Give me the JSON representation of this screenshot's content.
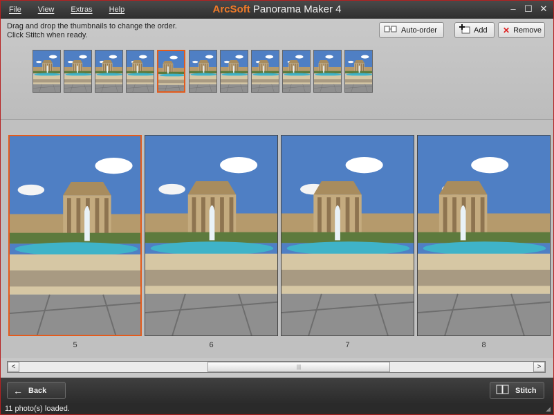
{
  "menu": {
    "file": "File",
    "view": "View",
    "extras": "Extras",
    "help": "Help"
  },
  "title": {
    "brand": "ArcSoft",
    "product": " Panorama Maker 4"
  },
  "window_controls": {
    "minimize": "–",
    "maximize": "☐",
    "close": "✕"
  },
  "instructions": {
    "line1": "Drag and drop the thumbnails to change the order.",
    "line2": "Click Stitch when ready."
  },
  "toolbar": {
    "auto_order_label": "Auto-order",
    "add_label": "Add",
    "remove_label": "Remove",
    "auto_order_icon": "auto-order-icon",
    "add_icon": "add-photo-icon",
    "remove_icon": "remove-x-icon"
  },
  "thumbnails": [
    "1",
    "2",
    "3",
    "4",
    "5",
    "6",
    "7",
    "8",
    "9",
    "10",
    "11"
  ],
  "selected_thumbnail": "5",
  "main_photos": [
    "5",
    "6",
    "7",
    "8"
  ],
  "selected_photo": "5",
  "scroll": {
    "left_arrow": "<",
    "right_arrow": ">",
    "grip": "|||"
  },
  "buttons": {
    "back_label": "Back",
    "stitch_label": "Stitch",
    "back_icon": "left-arrow-icon",
    "stitch_icon": "stitch-icon"
  },
  "status": {
    "text": "11 photo(s) loaded."
  },
  "colors": {
    "accent": "#e35b1c",
    "brand": "#f07a28",
    "sky": "#4f7fc4"
  }
}
